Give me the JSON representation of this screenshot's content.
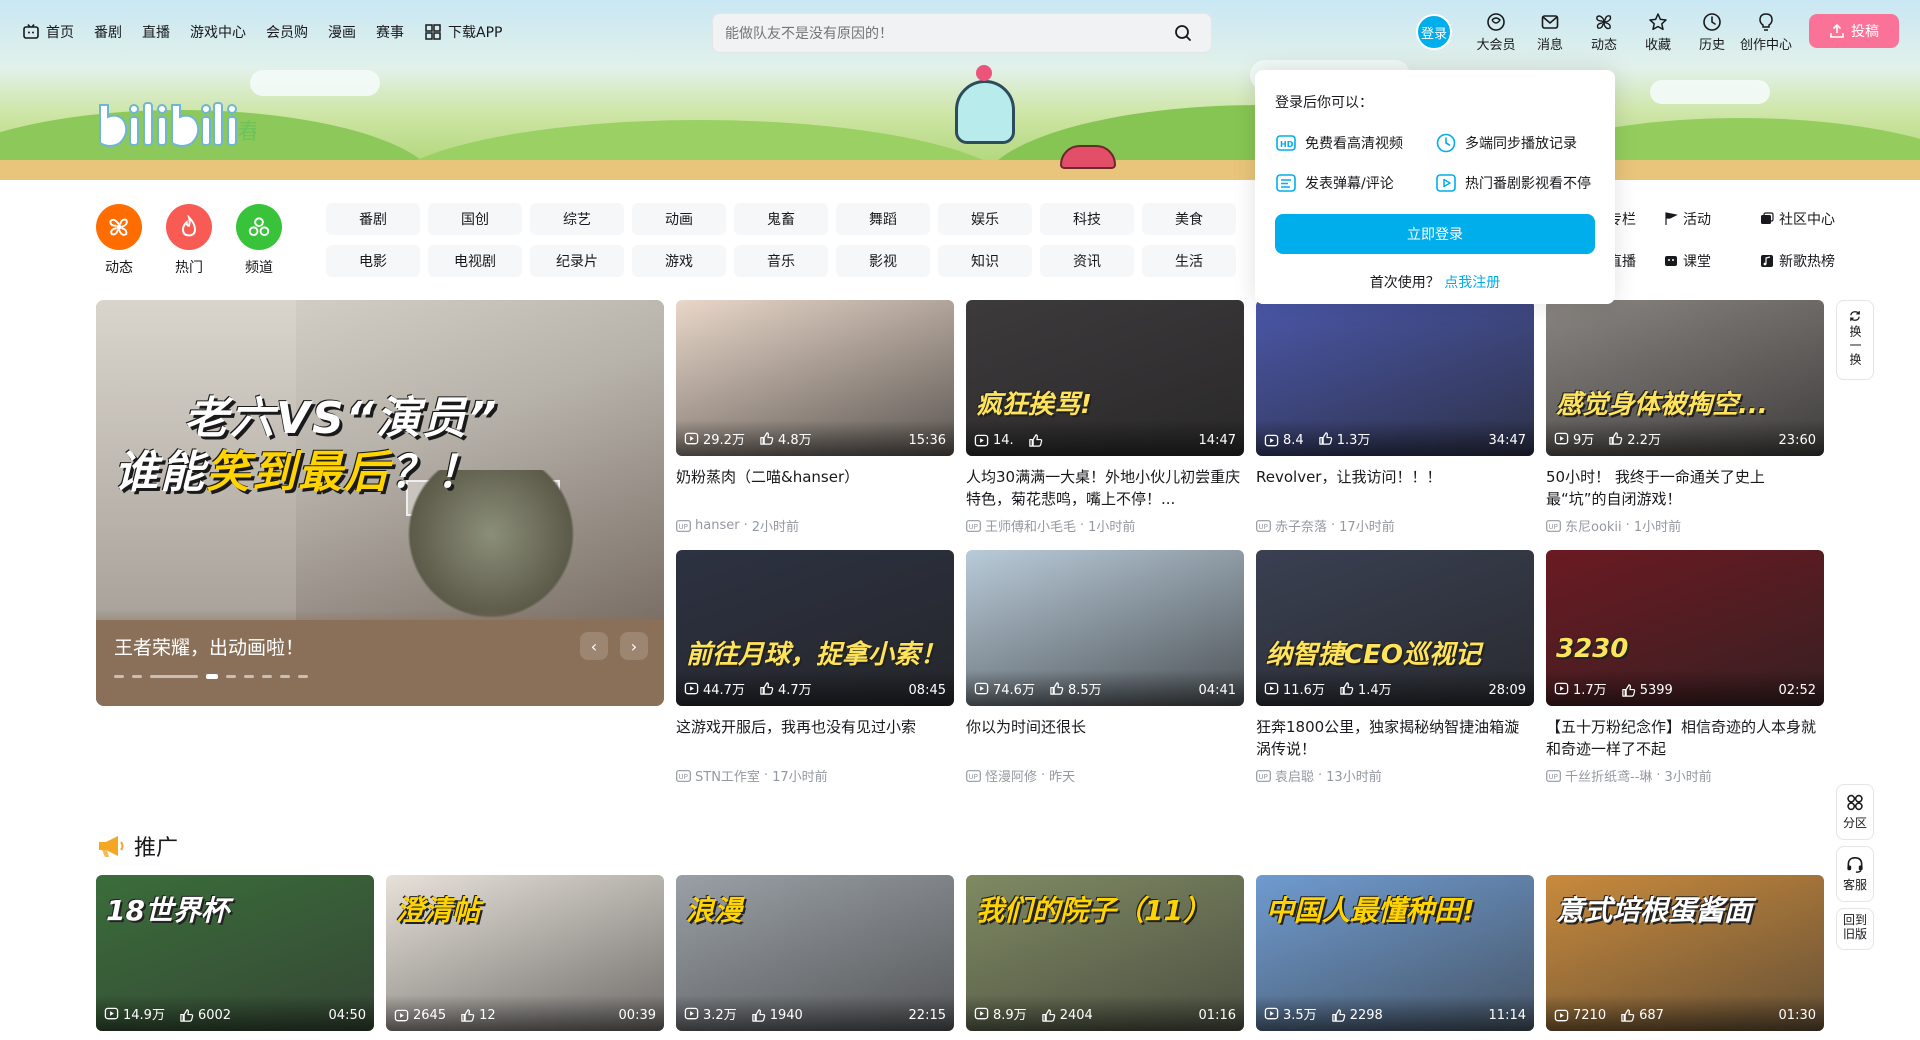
{
  "topnav": [
    {
      "label": "首页",
      "icon": "tv-icon"
    },
    {
      "label": "番剧"
    },
    {
      "label": "直播"
    },
    {
      "label": "游戏中心"
    },
    {
      "label": "会员购"
    },
    {
      "label": "漫画"
    },
    {
      "label": "赛事"
    },
    {
      "label": "下载APP",
      "icon": "download-icon"
    }
  ],
  "search": {
    "placeholder": "能做队友不是没有原因的！"
  },
  "rightnav": {
    "login": "登录",
    "items": [
      {
        "label": "大会员",
        "icon": "vip-icon"
      },
      {
        "label": "消息",
        "icon": "message-icon"
      },
      {
        "label": "动态",
        "icon": "dynamic-icon"
      },
      {
        "label": "收藏",
        "icon": "star-icon"
      },
      {
        "label": "历史",
        "icon": "clock-icon"
      },
      {
        "label": "创作中心",
        "icon": "bulb-icon"
      }
    ],
    "post": "投稿"
  },
  "channels": {
    "main": [
      {
        "label": "动态",
        "color": "#ff6d00"
      },
      {
        "label": "热门",
        "color": "#f85a54"
      },
      {
        "label": "频道",
        "color": "#38c33a"
      }
    ],
    "tags_row1": [
      "番剧",
      "国创",
      "综艺",
      "动画",
      "鬼畜",
      "舞蹈",
      "娱乐",
      "科技",
      "美食"
    ],
    "tags_row2": [
      "电影",
      "电视剧",
      "纪录片",
      "游戏",
      "音乐",
      "影视",
      "知识",
      "资讯",
      "生活"
    ],
    "extra": [
      "专栏",
      "活动",
      "社区中心",
      "直播",
      "课堂",
      "新歌热榜"
    ]
  },
  "carousel": {
    "headline1": "老六VS“演员”",
    "headline2_a": "谁能",
    "headline2_b": "笑到最后",
    "headline2_c": "？！",
    "caption": "王者荣耀，出动画啦！",
    "prev": "‹",
    "next": "›"
  },
  "videos": [
    {
      "views": "29.2万",
      "likes": "4.8万",
      "duration": "15:36",
      "title": "奶粉蒸肉（二喵&hanser）",
      "author": "hanser",
      "time": "2小时前",
      "bg": "#e9d7c9"
    },
    {
      "views": "14.",
      "likes": "",
      "duration": "14:47",
      "title": "人均30满满一大桌！外地小伙儿初尝重庆特色，菊花悲鸣，嘴上不停！...",
      "author": "王师傅和小毛毛",
      "time": "1小时前",
      "bg": "#3d3a3c",
      "overlay": "疯狂挨骂!"
    },
    {
      "views": "8.4",
      "likes": "1.3万",
      "duration": "34:47",
      "title": "Revolver，让我访问！！！",
      "author": "赤子奈落",
      "time": "17小时前",
      "bg": "#4a57a8"
    },
    {
      "views": "9万",
      "likes": "2.2万",
      "duration": "23:60",
      "title": "50小时！ 我终于一命通关了史上最“坑”的自闭游戏！",
      "author": "东尼ookii",
      "time": "1小时前",
      "bg": "#8a8581",
      "overlay": "感觉身体被掏空..."
    },
    {
      "views": "44.7万",
      "likes": "4.7万",
      "duration": "08:45",
      "title": "这游戏开服后，我再也没有见过小索",
      "author": "STN工作室",
      "time": "17小时前",
      "bg": "#2d3242",
      "overlay": "前往月球，捉拿小索！"
    },
    {
      "views": "74.6万",
      "likes": "8.5万",
      "duration": "04:41",
      "title": "你以为时间还很长",
      "author": "怪漫阿修",
      "time": "昨天",
      "bg": "#b9cbd9"
    },
    {
      "views": "11.6万",
      "likes": "1.4万",
      "duration": "28:09",
      "title": "狂奔1800公里，独家揭秘纳智捷油箱漩涡传说！",
      "author": "袁启聪",
      "time": "13小时前",
      "bg": "#3a4052",
      "overlay": "纳智捷CEO巡视记"
    },
    {
      "views": "1.7万",
      "likes": "5399",
      "duration": "02:52",
      "title": "【五十万粉纪念作】相信奇迹的人本身就和奇迹一样了不起",
      "author": "千丝折纸鸢--琳",
      "time": "3小时前",
      "bg": "#6b1a22",
      "overlay": "3230"
    }
  ],
  "login_popover": {
    "title": "登录后你可以：",
    "features": [
      {
        "label": "免费看高清视频",
        "icon": "hd-icon"
      },
      {
        "label": "多端同步播放记录",
        "icon": "history-sync-icon"
      },
      {
        "label": "发表弹幕/评论",
        "icon": "danmaku-icon"
      },
      {
        "label": "热门番剧影视看不停",
        "icon": "play-icon"
      }
    ],
    "button": "立即登录",
    "register_prefix": "首次使用？",
    "register_link": "点我注册"
  },
  "promo": {
    "title": "推广",
    "items": [
      {
        "views": "14.9万",
        "likes": "6002",
        "duration": "04:50",
        "bg": "#3a6d3a",
        "overlay": "18世界杯"
      },
      {
        "views": "2645",
        "likes": "12",
        "duration": "00:39",
        "bg": "#e7e1d9",
        "overlay": "澄清帖"
      },
      {
        "views": "3.2万",
        "likes": "1940",
        "duration": "22:15",
        "bg": "#9aa0a6",
        "overlay": "浪漫"
      },
      {
        "views": "8.9万",
        "likes": "2404",
        "duration": "01:16",
        "bg": "#7f8a62",
        "overlay": "我们的院子（11）"
      },
      {
        "views": "3.5万",
        "likes": "2298",
        "duration": "11:14",
        "bg": "#6f9bd0",
        "overlay": "中国人最懂种田!"
      },
      {
        "views": "7210",
        "likes": "687",
        "duration": "01:30",
        "bg": "#c98a3c",
        "overlay": "意式培根蛋酱面"
      }
    ]
  },
  "side": {
    "refresh": "换一换",
    "partition": "分区",
    "service": "客服",
    "old": "回到旧版"
  }
}
